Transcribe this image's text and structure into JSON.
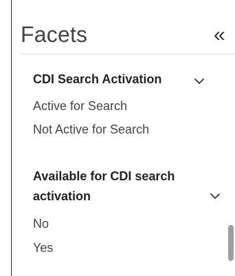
{
  "header": {
    "title": "Facets",
    "collapse_icon": "double-chevron-left-icon",
    "collapse_glyph": "«"
  },
  "facets": [
    {
      "title": "CDI Search Activation",
      "items": [
        "Active for Search",
        "Not Active for Search"
      ]
    },
    {
      "title_line1": "Available for CDI search",
      "title_line2": "activation",
      "items": [
        "No",
        "Yes"
      ]
    }
  ]
}
